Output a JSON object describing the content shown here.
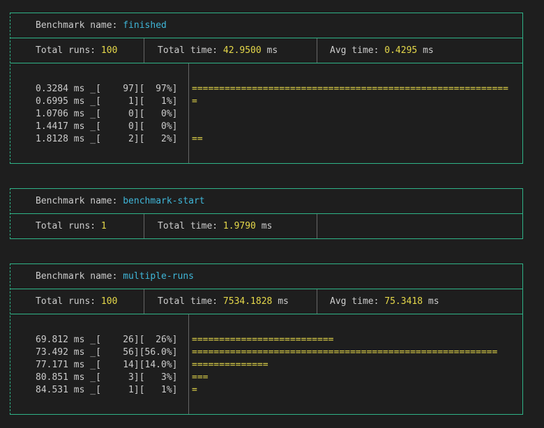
{
  "labels": {
    "benchmark_name": "Benchmark name: ",
    "total_runs": "Total runs: ",
    "total_time": "Total time: ",
    "avg_time": "Avg time: ",
    "unit_ms": " ms"
  },
  "benchmarks": [
    {
      "name": "finished",
      "total_runs": "100",
      "total_time": "42.9500",
      "avg_time": "0.4295",
      "histogram": [
        {
          "text": "0.3284 ms _[    97][  97%]",
          "bar": "=========================================================="
        },
        {
          "text": "0.6995 ms _[     1][   1%]",
          "bar": "="
        },
        {
          "text": "1.0706 ms _[     0][   0%]",
          "bar": ""
        },
        {
          "text": "1.4417 ms _[     0][   0%]",
          "bar": ""
        },
        {
          "text": "1.8128 ms _[     2][   2%]",
          "bar": "=="
        }
      ]
    },
    {
      "name": "benchmark-start",
      "total_runs": "1",
      "total_time": "1.9790"
    },
    {
      "name": "multiple-runs",
      "total_runs": "100",
      "total_time": "7534.1828",
      "avg_time": "75.3418",
      "histogram": [
        {
          "text": "69.812 ms _[    26][  26%]",
          "bar": "=========================="
        },
        {
          "text": "73.492 ms _[    56][56.0%]",
          "bar": "========================================================"
        },
        {
          "text": "77.171 ms _[    14][14.0%]",
          "bar": "=============="
        },
        {
          "text": "80.851 ms _[     3][   3%]",
          "bar": "==="
        },
        {
          "text": "84.531 ms _[     1][   1%]",
          "bar": "="
        }
      ]
    }
  ]
}
